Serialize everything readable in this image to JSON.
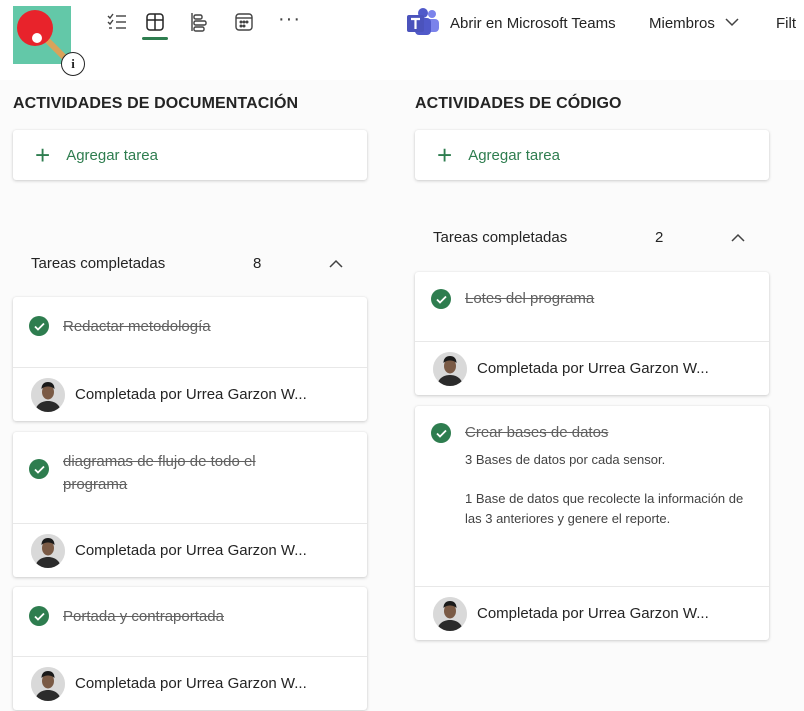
{
  "header": {
    "teams_label": "Abrir en Microsoft Teams",
    "members_label": "Miembros",
    "filter_label": "Filt",
    "info_label": "i",
    "view_icons": [
      "checklist-icon",
      "board-icon",
      "timeline-icon",
      "calendar-icon",
      "more-icon"
    ]
  },
  "buckets": [
    {
      "title": "ACTIVIDADES DE DOCUMENTACIÓN",
      "add_label": "Agregar tarea",
      "completed_label": "Tareas completadas",
      "completed_count": "8",
      "tasks": [
        {
          "title": "Redactar metodología",
          "footer": "Completada por Urrea Garzon W..."
        },
        {
          "title": "diagramas de flujo de todo el programa",
          "footer": "Completada por Urrea Garzon W..."
        },
        {
          "title": "Portada y contraportada",
          "footer": "Completada por Urrea Garzon W..."
        }
      ]
    },
    {
      "title": "ACTIVIDADES DE CÓDIGO",
      "add_label": "Agregar tarea",
      "completed_label": "Tareas completadas",
      "completed_count": "2",
      "tasks": [
        {
          "title": "Lotes del programa",
          "footer": "Completada por Urrea Garzon W..."
        },
        {
          "title": "Crear bases de datos",
          "desc1": "3 Bases de datos por cada sensor.",
          "desc2": "1 Base de datos que recolecte la información de las 3 anteriores y genere el reporte.",
          "footer": "Completada por Urrea Garzon W..."
        }
      ]
    }
  ],
  "colors": {
    "accent": "#2e7d4f",
    "plan_avatar_bg": "#63c8a8",
    "paddle": "#e8232b"
  }
}
